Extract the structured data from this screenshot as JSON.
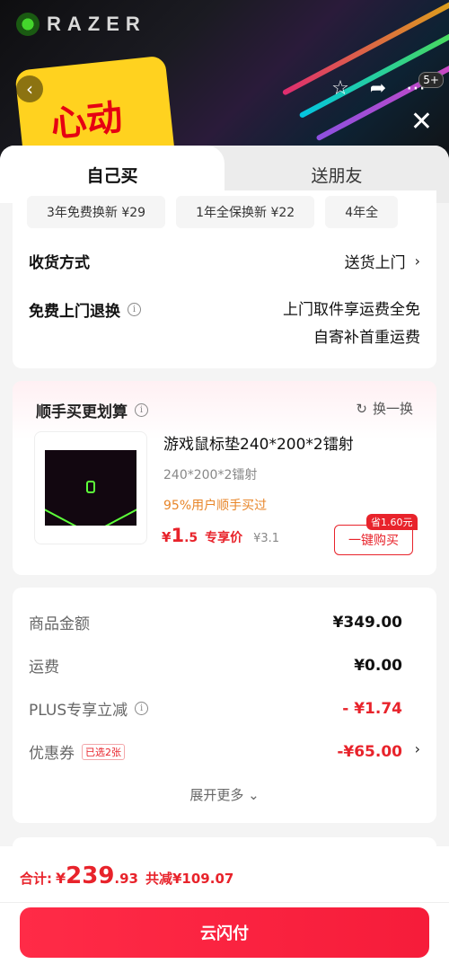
{
  "banner": {
    "brand": "RAZER",
    "promo_text": "心动",
    "cart_badge": "5+"
  },
  "tabs": [
    {
      "label": "自己买",
      "active": true
    },
    {
      "label": "送朋友",
      "active": false
    }
  ],
  "service_plans": [
    {
      "label": "3年免费换新 ¥29"
    },
    {
      "label": "1年全保换新 ¥22"
    },
    {
      "label": "4年全"
    }
  ],
  "delivery": {
    "label": "收货方式",
    "value": "送货上门"
  },
  "returns": {
    "label": "免费上门退换",
    "line1": "上门取件享运费全免",
    "line2": "自寄补首重运费"
  },
  "addon": {
    "title": "顺手买更划算",
    "refresh_label": "换一换",
    "product_name": "游戏鼠标垫240*200*2镭射",
    "spec": "240*200*2镭射",
    "buyers": "95%用户顺手买过",
    "price_yen": "¥",
    "price_int": "1",
    "price_dec": ".5",
    "price_tag": "专享价",
    "original_price": "¥3.1",
    "save_badge": "省1.60元",
    "buy_label": "一键购买"
  },
  "summary": {
    "rows": [
      {
        "label": "商品金额",
        "value": "¥349.00"
      },
      {
        "label": "运费",
        "value": "¥0.00"
      },
      {
        "label": "PLUS专享立减",
        "value": "- ¥1.74"
      },
      {
        "label": "优惠券",
        "tag": "已选2张",
        "value": "-¥65.00"
      }
    ],
    "expand_label": "展开更多"
  },
  "checkout": {
    "total_label": "合计:",
    "total_yen": "¥",
    "total_int": "239",
    "total_dec": ".93",
    "saved_label": "共减¥109.07",
    "pay_label": "云闪付"
  },
  "colors": {
    "accent": "#e8232b",
    "warning": "#e8862a",
    "pay_button": "#ff2b47"
  }
}
